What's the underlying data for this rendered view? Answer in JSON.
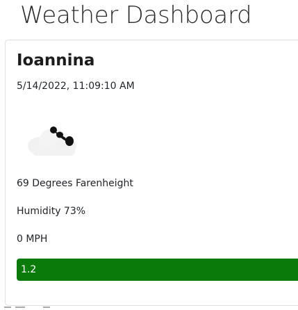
{
  "dashboard": {
    "title": "Weather Dashboard"
  },
  "current": {
    "city": "Ioannina",
    "datetime": "5/14/2022, 11:09:10 AM",
    "icon": "cloud-with-wind-icon",
    "temperature": "69 Degrees Farenheight",
    "humidity": "Humidity 73%",
    "wind": "0 MPH",
    "uv_index": "1.2",
    "uv_color": "#0a7a0a"
  }
}
